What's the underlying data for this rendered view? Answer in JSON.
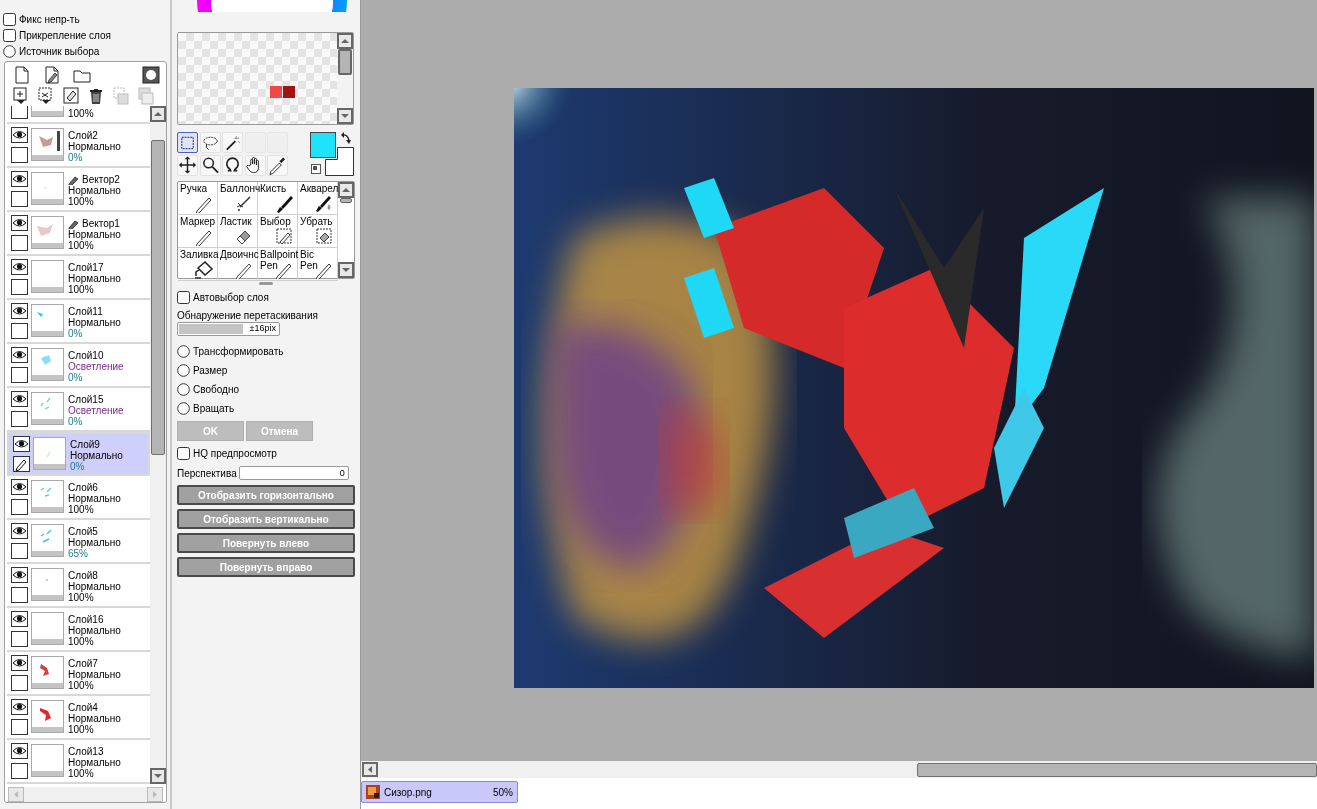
{
  "options": [
    {
      "kind": "checkbox",
      "label": "Фикс непр-ть",
      "checked": false
    },
    {
      "kind": "checkbox",
      "label": "Прикрепление слоя",
      "checked": false
    },
    {
      "kind": "radio",
      "label": "Источник выбора",
      "checked": false
    }
  ],
  "layers": [
    {
      "opacity": "100%",
      "opacity_highlighted": false,
      "selected": false
    },
    {
      "name": "Слой2",
      "kind": "raster",
      "mode": "Нормально",
      "opacity": "0%",
      "visible": true,
      "selected": false,
      "mode_highlighted": false,
      "opacity_highlighted": true
    },
    {
      "name": "Вектор2",
      "kind": "vector",
      "mode": "Нормально",
      "opacity": "100%",
      "visible": true,
      "selected": false,
      "mode_highlighted": false,
      "opacity_highlighted": false
    },
    {
      "name": "Вектор1",
      "kind": "vector",
      "mode": "Нормально",
      "opacity": "100%",
      "visible": true,
      "selected": false,
      "mode_highlighted": false,
      "opacity_highlighted": false
    },
    {
      "name": "Слой17",
      "kind": "raster",
      "mode": "Нормально",
      "opacity": "100%",
      "visible": true,
      "selected": false,
      "mode_highlighted": false,
      "opacity_highlighted": false
    },
    {
      "name": "Слой11",
      "kind": "raster",
      "mode": "Нормально",
      "opacity": "0%",
      "visible": true,
      "selected": false,
      "mode_highlighted": false,
      "opacity_highlighted": true
    },
    {
      "name": "Слой10",
      "kind": "raster",
      "mode": "Осветление",
      "opacity": "0%",
      "visible": true,
      "selected": false,
      "mode_highlighted": true,
      "opacity_highlighted": true
    },
    {
      "name": "Слой15",
      "kind": "raster",
      "mode": "Осветление",
      "opacity": "0%",
      "visible": true,
      "selected": false,
      "mode_highlighted": true,
      "opacity_highlighted": true
    },
    {
      "name": "Слой9",
      "kind": "raster",
      "mode": "Нормально",
      "opacity": "0%",
      "visible": true,
      "selected": true,
      "mode_highlighted": false,
      "opacity_highlighted": true
    },
    {
      "name": "Слой6",
      "kind": "raster",
      "mode": "Нормально",
      "opacity": "100%",
      "visible": true,
      "selected": false,
      "mode_highlighted": false,
      "opacity_highlighted": false
    },
    {
      "name": "Слой5",
      "kind": "raster",
      "mode": "Нормально",
      "opacity": "65%",
      "visible": true,
      "selected": false,
      "mode_highlighted": false,
      "opacity_highlighted": true
    },
    {
      "name": "Слой8",
      "kind": "raster",
      "mode": "Нормально",
      "opacity": "100%",
      "visible": true,
      "selected": false,
      "mode_highlighted": false,
      "opacity_highlighted": false
    },
    {
      "name": "Слой16",
      "kind": "raster",
      "mode": "Нормально",
      "opacity": "100%",
      "visible": true,
      "selected": false,
      "mode_highlighted": false,
      "opacity_highlighted": false
    },
    {
      "name": "Слой7",
      "kind": "raster",
      "mode": "Нормально",
      "opacity": "100%",
      "visible": true,
      "selected": false,
      "mode_highlighted": false,
      "opacity_highlighted": false
    },
    {
      "name": "Слой4",
      "kind": "raster",
      "mode": "Нормально",
      "opacity": "100%",
      "visible": true,
      "selected": false,
      "mode_highlighted": false,
      "opacity_highlighted": false
    },
    {
      "name": "Слой13",
      "kind": "raster",
      "mode": "Нормально",
      "opacity": "100%",
      "visible": true,
      "selected": false,
      "mode_highlighted": false,
      "opacity_highlighted": false
    }
  ],
  "swatches": [
    {
      "color": "#f04848"
    },
    {
      "color": "#a01414"
    }
  ],
  "tool_buttons": [
    {
      "kind": "rect-select",
      "selected": true
    },
    {
      "kind": "lasso",
      "selected": false
    },
    {
      "kind": "wand",
      "selected": false
    },
    {
      "kind": "empty",
      "selected": false
    },
    {
      "kind": "empty",
      "selected": false
    },
    {
      "kind": "move",
      "selected": false
    },
    {
      "kind": "zoom",
      "selected": false
    },
    {
      "kind": "rotate",
      "selected": false
    },
    {
      "kind": "hand",
      "selected": false
    },
    {
      "kind": "eyedropper",
      "selected": false
    }
  ],
  "colors": {
    "foreground": {
      "color": "#1fe3fd"
    },
    "background": {
      "color": "#ffffff"
    }
  },
  "brushes": [
    {
      "label": "Ручка",
      "kind": "pen"
    },
    {
      "label": "Баллонч",
      "kind": "airbrush"
    },
    {
      "label": "Кисть",
      "kind": "brush"
    },
    {
      "label": "Акварел",
      "kind": "watercolor"
    },
    {
      "label": "Маркер",
      "kind": "pen"
    },
    {
      "label": "Ластик",
      "kind": "eraser"
    },
    {
      "label": "Выбор",
      "kind": "select"
    },
    {
      "label": "Убрать",
      "kind": "deselect"
    },
    {
      "label": "Заливка",
      "kind": "fill"
    },
    {
      "label": "Двоичнс",
      "kind": "pencil"
    },
    {
      "label": "Ballpoint Pen",
      "kind": "pen"
    },
    {
      "label": "Bic Pen",
      "kind": "pen"
    }
  ],
  "auto_select": {
    "label": "Автовыбор слоя",
    "checked": false
  },
  "drag_detect": {
    "label": "Обнаружение перетаскивания",
    "level": 0.63,
    "reading": "±16pix"
  },
  "transform_modes": [
    {
      "label": "Трансформировать",
      "selected": false
    },
    {
      "label": "Размер",
      "selected": false
    },
    {
      "label": "Свободно",
      "selected": false
    },
    {
      "label": "Вращать",
      "selected": false
    }
  ],
  "confirm_buttons": [
    {
      "label": "OK",
      "disabled": true
    },
    {
      "label": "Отмена",
      "disabled": true
    }
  ],
  "hq_preview": {
    "label": "HQ предпросмотр",
    "checked": false
  },
  "perspective": {
    "label": "Перспектива",
    "value": "0"
  },
  "action_buttons": [
    "Отобразить горизонтально",
    "Отобразить вертикально",
    "Повернуть влево",
    "Повернуть вправо"
  ],
  "document_tabs": [
    {
      "title": "Сизор.png",
      "zoom": "50%",
      "selected": true
    }
  ]
}
